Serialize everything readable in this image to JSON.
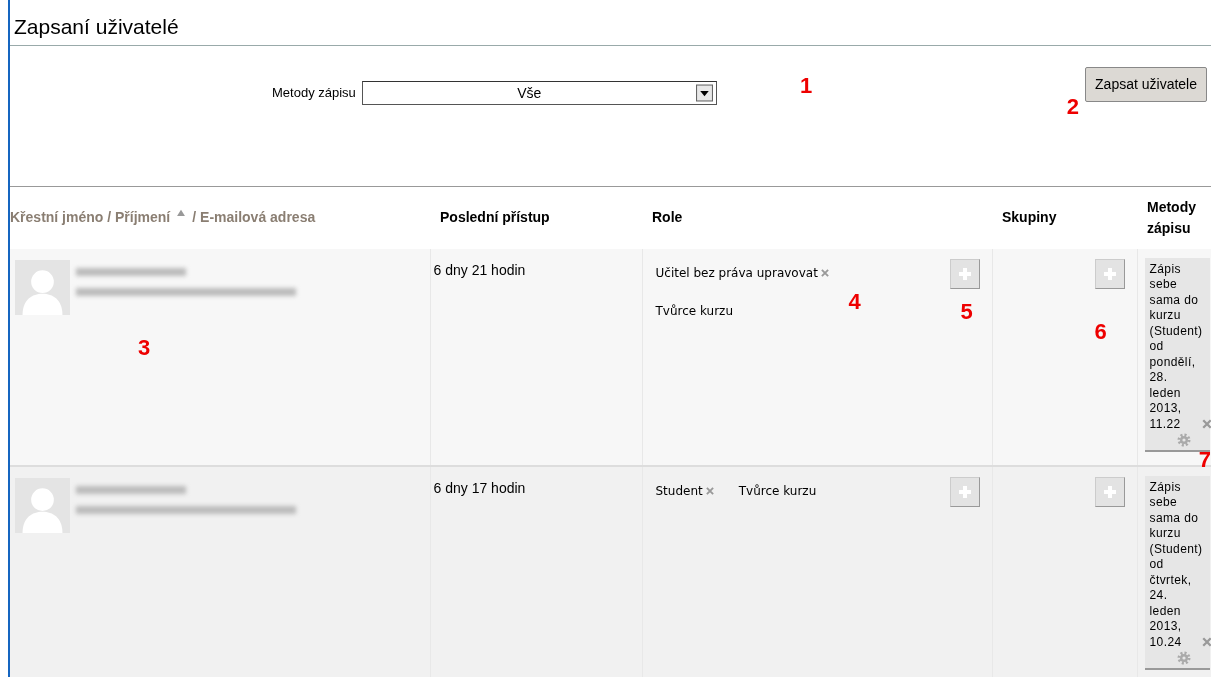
{
  "page": {
    "title": "Zapsaní uživatelé"
  },
  "filter": {
    "label": "Metody zápisu",
    "value": "Vše",
    "annotation": "1"
  },
  "enrol_button": {
    "label": "Zapsat uživatele",
    "annotation": "2"
  },
  "table": {
    "name_header": {
      "first": "Křestní jméno / Příjmení",
      "second": "/ E-mailová adresa",
      "sort_ascending": true
    },
    "columns": [
      "Poslední přístup",
      "Role",
      "Skupiny",
      "Metody zápisu"
    ],
    "rows": [
      {
        "annotation": "3",
        "last_access": "6 dny 21 hodin",
        "roles": [
          {
            "label": "Učitel bez práva upravovat",
            "removable": true,
            "annotation": "4"
          },
          {
            "label": "Tvůrce kurzu",
            "removable": false
          }
        ],
        "role_add_annotation": "5",
        "group_add_annotation": "6",
        "enrolments": [
          "Zápis sebe sama do kurzu (Student) od pondělí, 28. leden 2013, 11.22"
        ],
        "enrolment_annotation": "7"
      },
      {
        "last_access": "6 dny 17 hodin",
        "roles": [
          {
            "label": "Student",
            "removable": true
          },
          {
            "label": "Tvůrce kurzu",
            "removable": false
          }
        ],
        "enrolments": [
          "Zápis sebe sama do kurzu (Student) od čtvrtek, 24. leden 2013, 10.24"
        ]
      }
    ]
  }
}
